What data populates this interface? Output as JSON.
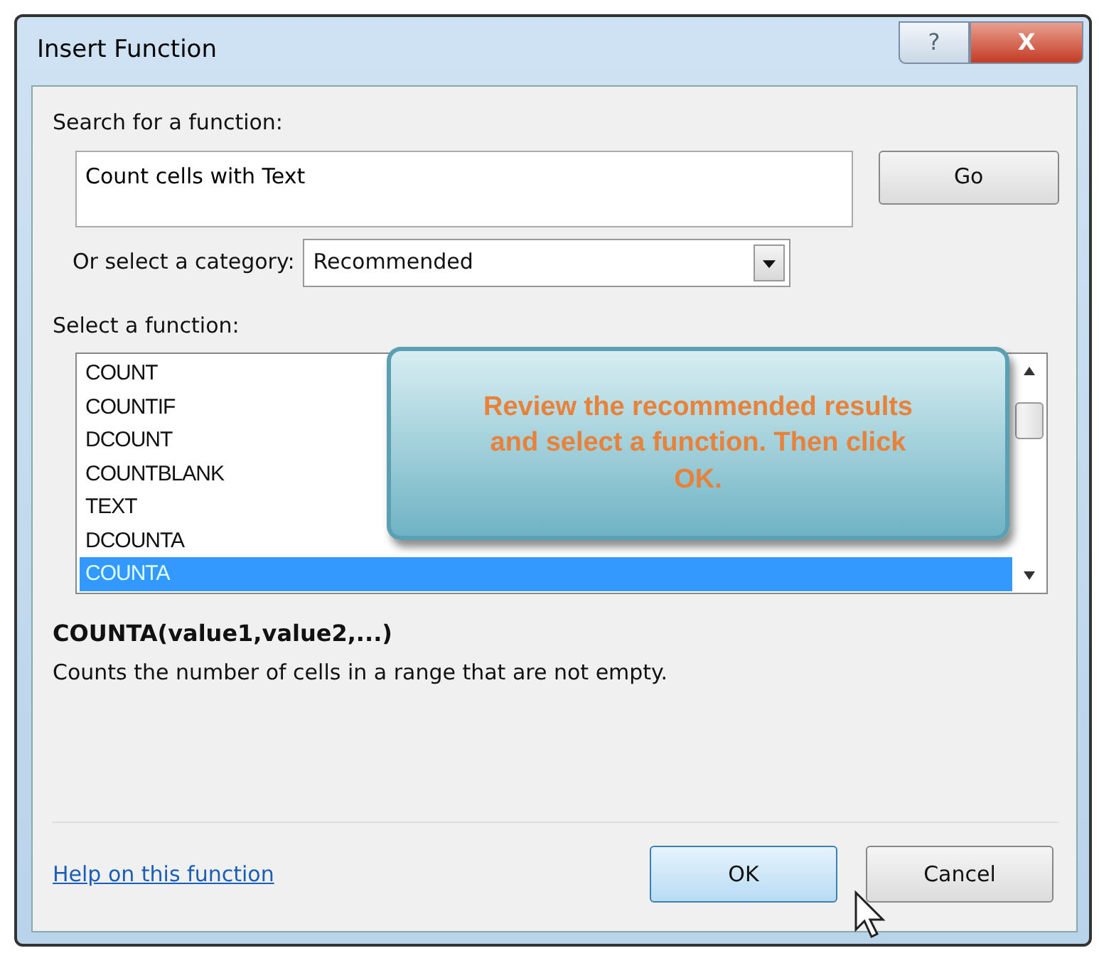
{
  "window": {
    "title": "Insert Function",
    "help_button": "?",
    "close_button": "X"
  },
  "search": {
    "label": "Search for a function:",
    "value": "Count cells with Text",
    "go_button": "Go"
  },
  "category": {
    "label": "Or select a category:",
    "value": "Recommended"
  },
  "functions": {
    "label": "Select a function:",
    "items": [
      {
        "name": "COUNT",
        "selected": false
      },
      {
        "name": "COUNTIF",
        "selected": false
      },
      {
        "name": "DCOUNT",
        "selected": false
      },
      {
        "name": "COUNTBLANK",
        "selected": false
      },
      {
        "name": "TEXT",
        "selected": false
      },
      {
        "name": "DCOUNTA",
        "selected": false
      },
      {
        "name": "COUNTA",
        "selected": true
      }
    ]
  },
  "description": {
    "signature": "COUNTA(value1,value2,...)",
    "text": "Counts the number of cells in a range that are not empty."
  },
  "callout": {
    "text": "Review the recommended results and select a function. Then click OK."
  },
  "footer": {
    "help_link": "Help on this function",
    "ok_button": "OK",
    "cancel_button": "Cancel"
  }
}
